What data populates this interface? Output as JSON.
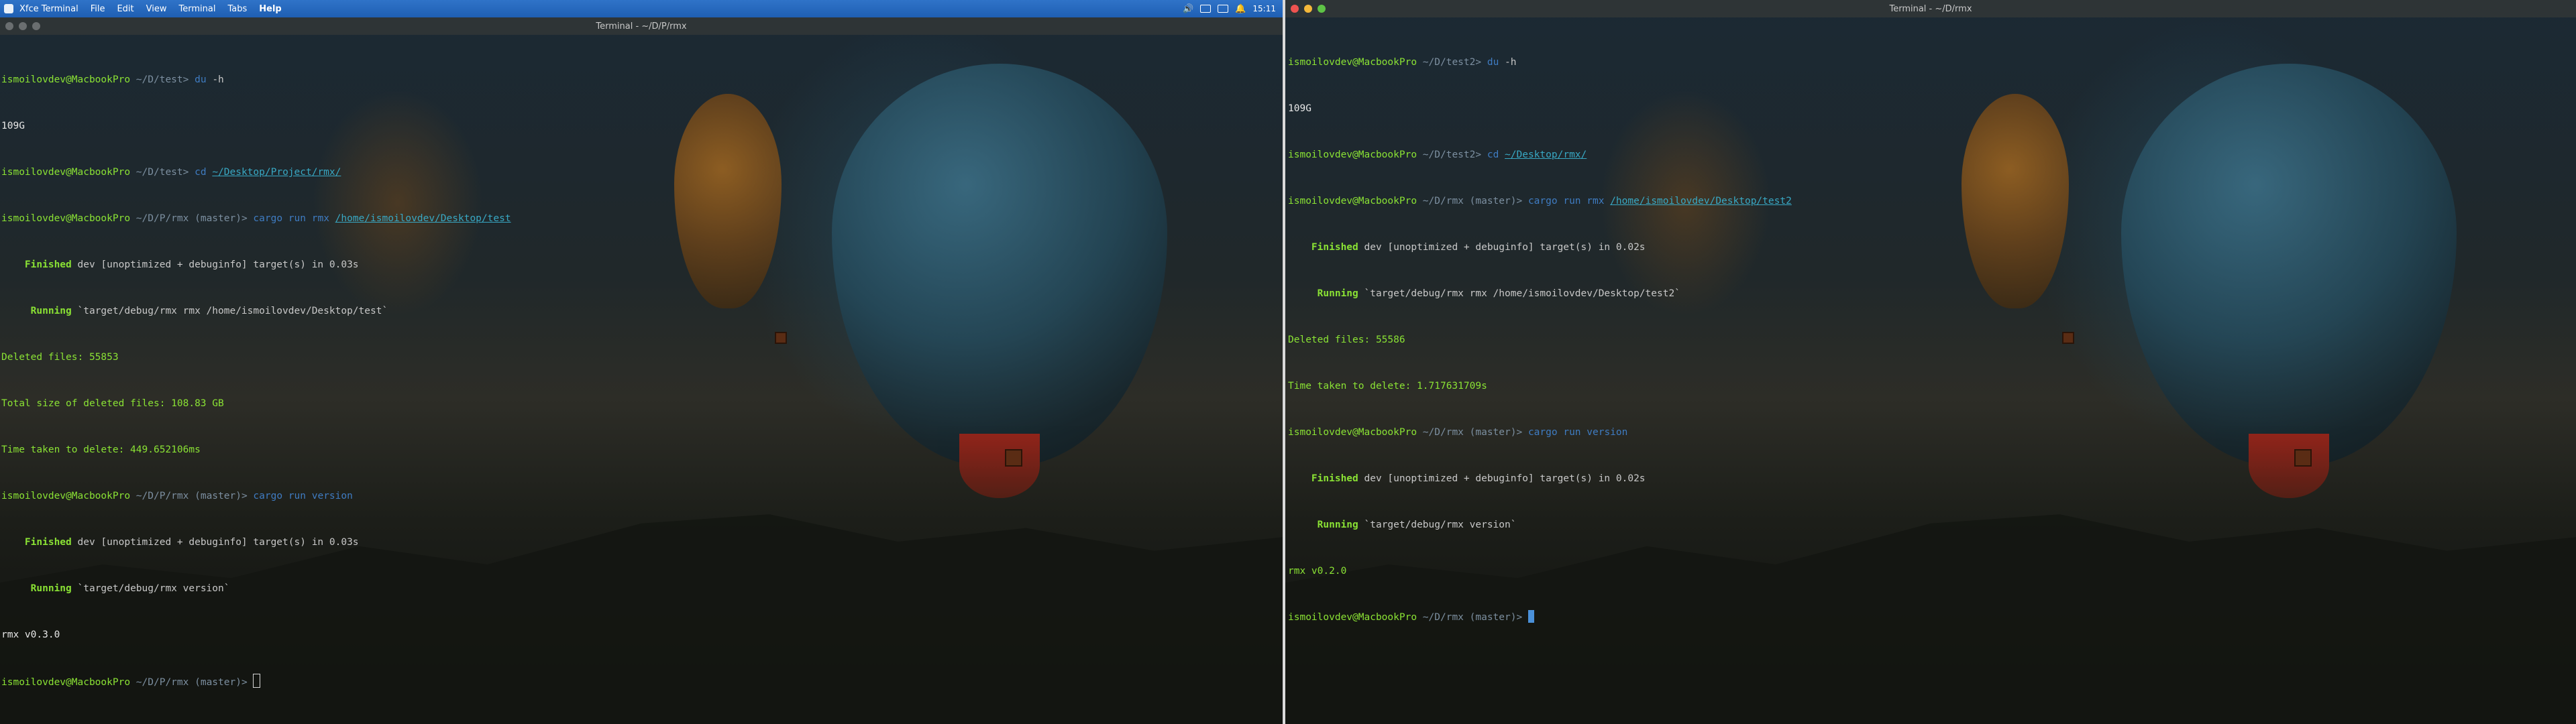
{
  "topbar": {
    "menus": [
      "Xfce Terminal",
      "File",
      "Edit",
      "View",
      "Terminal",
      "Tabs",
      "Help"
    ],
    "clock": "15:11"
  },
  "left": {
    "title": "Terminal - ~/D/P/rmx",
    "lines": {
      "l1_user": "ismoilovdev@MacbookPro",
      "l1_path": "~/D/test>",
      "l1_cmd": "du",
      "l1_arg": "-h",
      "l2": "109G",
      "l3_user": "ismoilovdev@MacbookPro",
      "l3_path": "~/D/test>",
      "l3_cmd": "cd",
      "l3_link": "~/Desktop/Project/rmx/",
      "l4_user": "ismoilovdev@MacbookPro",
      "l4_path": "~/D/P/rmx",
      "l4_branch": "(master)>",
      "l4_cmd": "cargo",
      "l4_args": "run rmx",
      "l4_link": "/home/ismoilovdev/Desktop/test",
      "l5_kw": "Finished",
      "l5_rest": "dev [unoptimized + debuginfo] target(s) in 0.03s",
      "l6_kw": "Running",
      "l6_rest": "`target/debug/rmx rmx /home/ismoilovdev/Desktop/test`",
      "l7": "Deleted files: 55853",
      "l8": "Total size of deleted files: 108.83 GB",
      "l9": "Time taken to delete: 449.652106ms",
      "l10_user": "ismoilovdev@MacbookPro",
      "l10_path": "~/D/P/rmx",
      "l10_branch": "(master)>",
      "l10_cmd": "cargo",
      "l10_args": "run version",
      "l11_kw": "Finished",
      "l11_rest": "dev [unoptimized + debuginfo] target(s) in 0.03s",
      "l12_kw": "Running",
      "l12_rest": "`target/debug/rmx version`",
      "l13": "rmx v0.3.0",
      "l14_user": "ismoilovdev@MacbookPro",
      "l14_path": "~/D/P/rmx",
      "l14_branch": "(master)>"
    }
  },
  "right": {
    "title": "Terminal - ~/D/rmx",
    "lines": {
      "l1_user": "ismoilovdev@MacbookPro",
      "l1_path": "~/D/test2>",
      "l1_cmd": "du",
      "l1_arg": "-h",
      "l2": "109G",
      "l3_user": "ismoilovdev@MacbookPro",
      "l3_path": "~/D/test2>",
      "l3_cmd": "cd",
      "l3_link": "~/Desktop/rmx/",
      "l4_user": "ismoilovdev@MacbookPro",
      "l4_path": "~/D/rmx",
      "l4_branch": "(master)>",
      "l4_cmd": "cargo",
      "l4_args": "run rmx",
      "l4_link": "/home/ismoilovdev/Desktop/test2",
      "l5_kw": "Finished",
      "l5_rest": "dev [unoptimized + debuginfo] target(s) in 0.02s",
      "l6_kw": "Running",
      "l6_rest": "`target/debug/rmx rmx /home/ismoilovdev/Desktop/test2`",
      "l7": "Deleted files: 55586",
      "l8": "Time taken to delete: 1.717631709s",
      "l9_user": "ismoilovdev@MacbookPro",
      "l9_path": "~/D/rmx",
      "l9_branch": "(master)>",
      "l9_cmd": "cargo",
      "l9_args": "run version",
      "l10_kw": "Finished",
      "l10_rest": "dev [unoptimized + debuginfo] target(s) in 0.02s",
      "l11_kw": "Running",
      "l11_rest": "`target/debug/rmx version`",
      "l12": "rmx v0.2.0",
      "l13_user": "ismoilovdev@MacbookPro",
      "l13_path": "~/D/rmx",
      "l13_branch": "(master)>"
    }
  }
}
